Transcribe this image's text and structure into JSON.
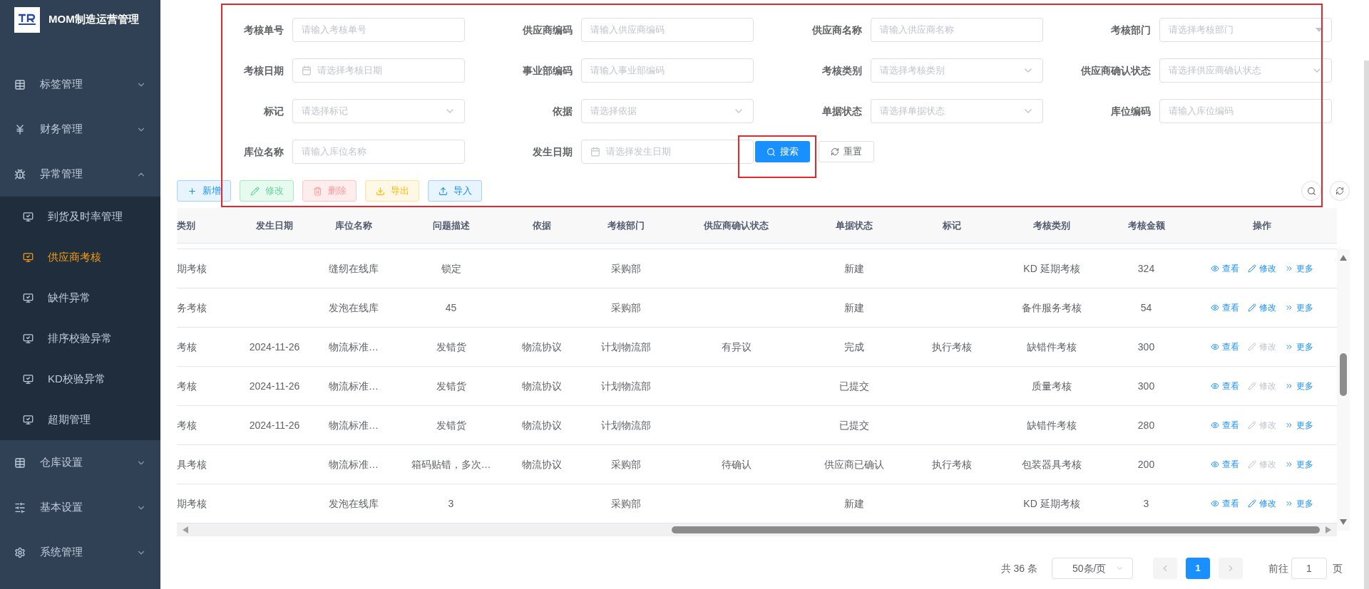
{
  "app": {
    "title": "MOM制造运营管理"
  },
  "sidebar": {
    "items": [
      {
        "label": "标签管理",
        "kind": "grid",
        "expanded": false
      },
      {
        "label": "财务管理",
        "kind": "yen",
        "expanded": false
      },
      {
        "label": "异常管理",
        "kind": "bug",
        "expanded": true,
        "children": [
          {
            "label": "到货及时率管理",
            "selected": false
          },
          {
            "label": "供应商考核",
            "selected": true
          },
          {
            "label": "缺件异常",
            "selected": false
          },
          {
            "label": "排序校验异常",
            "selected": false
          },
          {
            "label": "KD校验异常",
            "selected": false
          },
          {
            "label": "超期管理",
            "selected": false
          }
        ]
      },
      {
        "label": "仓库设置",
        "kind": "grid",
        "expanded": false
      },
      {
        "label": "基本设置",
        "kind": "sliders",
        "expanded": false
      },
      {
        "label": "系统管理",
        "kind": "gear",
        "expanded": false
      }
    ]
  },
  "filters": [
    {
      "label": "考核单号",
      "placeholder": "请输入考核单号",
      "kind": "text"
    },
    {
      "label": "供应商编码",
      "placeholder": "请输入供应商编码",
      "kind": "text"
    },
    {
      "label": "供应商名称",
      "placeholder": "请输入供应商名称",
      "kind": "text"
    },
    {
      "label": "考核部门",
      "placeholder": "请选择考核部门",
      "kind": "dropdown"
    },
    {
      "label": "考核日期",
      "placeholder": "请选择考核日期",
      "kind": "date"
    },
    {
      "label": "事业部编码",
      "placeholder": "请输入事业部编码",
      "kind": "text"
    },
    {
      "label": "考核类别",
      "placeholder": "请选择考核类别",
      "kind": "select"
    },
    {
      "label": "供应商确认状态",
      "placeholder": "请选择供应商确认状态",
      "kind": "select"
    },
    {
      "label": "标记",
      "placeholder": "请选择标记",
      "kind": "select"
    },
    {
      "label": "依据",
      "placeholder": "请选择依据",
      "kind": "select"
    },
    {
      "label": "单据状态",
      "placeholder": "请选择单据状态",
      "kind": "select"
    },
    {
      "label": "库位编码",
      "placeholder": "请输入库位编码",
      "kind": "text"
    },
    {
      "label": "库位名称",
      "placeholder": "请输入库位名称",
      "kind": "text"
    },
    {
      "label": "发生日期",
      "placeholder": "请选择发生日期",
      "kind": "date"
    }
  ],
  "search_buttons": [
    {
      "label": "搜索",
      "kind": "primary"
    },
    {
      "label": "重置",
      "kind": "default"
    }
  ],
  "toolbar": [
    {
      "label": "新增",
      "kind": "add"
    },
    {
      "label": "修改",
      "kind": "edit"
    },
    {
      "label": "删除",
      "kind": "delete"
    },
    {
      "label": "导出",
      "kind": "export"
    },
    {
      "label": "导入",
      "kind": "import"
    }
  ],
  "table": {
    "columns": [
      "类别",
      "发生日期",
      "库位名称",
      "问题描述",
      "依据",
      "考核部门",
      "供应商确认状态",
      "单据状态",
      "标记",
      "考核类别",
      "考核金额",
      "操作"
    ],
    "rows": [
      {
        "cells": [
          "期考核",
          "",
          "缝纫在线库",
          "锁定",
          "",
          "采购部",
          "",
          "新建",
          "",
          "KD 延期考核",
          "324"
        ],
        "actions": [
          {
            "label": "查看",
            "kind": "view",
            "disabled": false
          },
          {
            "label": "修改",
            "kind": "edit",
            "disabled": false
          },
          {
            "label": "更多",
            "kind": "more",
            "disabled": false
          }
        ]
      },
      {
        "cells": [
          "务考核",
          "",
          "发泡在线库",
          "45",
          "",
          "采购部",
          "",
          "新建",
          "",
          "备件服务考核",
          "54"
        ],
        "actions": [
          {
            "label": "查看",
            "kind": "view",
            "disabled": false
          },
          {
            "label": "修改",
            "kind": "edit",
            "disabled": false
          },
          {
            "label": "更多",
            "kind": "more",
            "disabled": false
          }
        ]
      },
      {
        "cells": [
          "考核",
          "2024-11-26",
          "物流标准…",
          "发错货",
          "物流协议",
          "计划物流部",
          "有异议",
          "完成",
          "执行考核",
          "缺错件考核",
          "300"
        ],
        "actions": [
          {
            "label": "查看",
            "kind": "view",
            "disabled": false
          },
          {
            "label": "修改",
            "kind": "edit",
            "disabled": true
          },
          {
            "label": "更多",
            "kind": "more",
            "disabled": false
          }
        ]
      },
      {
        "cells": [
          "考核",
          "2024-11-26",
          "物流标准…",
          "发错货",
          "物流协议",
          "计划物流部",
          "",
          "已提交",
          "",
          "质量考核",
          "300"
        ],
        "actions": [
          {
            "label": "查看",
            "kind": "view",
            "disabled": false
          },
          {
            "label": "修改",
            "kind": "edit",
            "disabled": true
          },
          {
            "label": "更多",
            "kind": "more",
            "disabled": false
          }
        ]
      },
      {
        "cells": [
          "考核",
          "2024-11-26",
          "物流标准…",
          "发错货",
          "物流协议",
          "计划物流部",
          "",
          "已提交",
          "",
          "缺错件考核",
          "280"
        ],
        "actions": [
          {
            "label": "查看",
            "kind": "view",
            "disabled": false
          },
          {
            "label": "修改",
            "kind": "edit",
            "disabled": true
          },
          {
            "label": "更多",
            "kind": "more",
            "disabled": false
          }
        ]
      },
      {
        "cells": [
          "具考核",
          "",
          "物流标准…",
          "箱码贴错，多次…",
          "物流协议",
          "采购部",
          "待确认",
          "供应商已确认",
          "执行考核",
          "包装器具考核",
          "200"
        ],
        "actions": [
          {
            "label": "查看",
            "kind": "view",
            "disabled": false
          },
          {
            "label": "修改",
            "kind": "edit",
            "disabled": true
          },
          {
            "label": "更多",
            "kind": "more",
            "disabled": false
          }
        ]
      },
      {
        "cells": [
          "期考核",
          "",
          "发泡在线库",
          "3",
          "",
          "采购部",
          "",
          "新建",
          "",
          "KD 延期考核",
          "3"
        ],
        "actions": [
          {
            "label": "查看",
            "kind": "view",
            "disabled": false
          },
          {
            "label": "修改",
            "kind": "edit",
            "disabled": false
          },
          {
            "label": "更多",
            "kind": "more",
            "disabled": false
          }
        ]
      }
    ]
  },
  "pagination": {
    "total": "共 36 条",
    "page_size": "50条/页",
    "pages": [
      {
        "label": "1",
        "selected": true
      }
    ],
    "goto_label": "前往",
    "goto_value": "1",
    "page_unit": "页"
  }
}
